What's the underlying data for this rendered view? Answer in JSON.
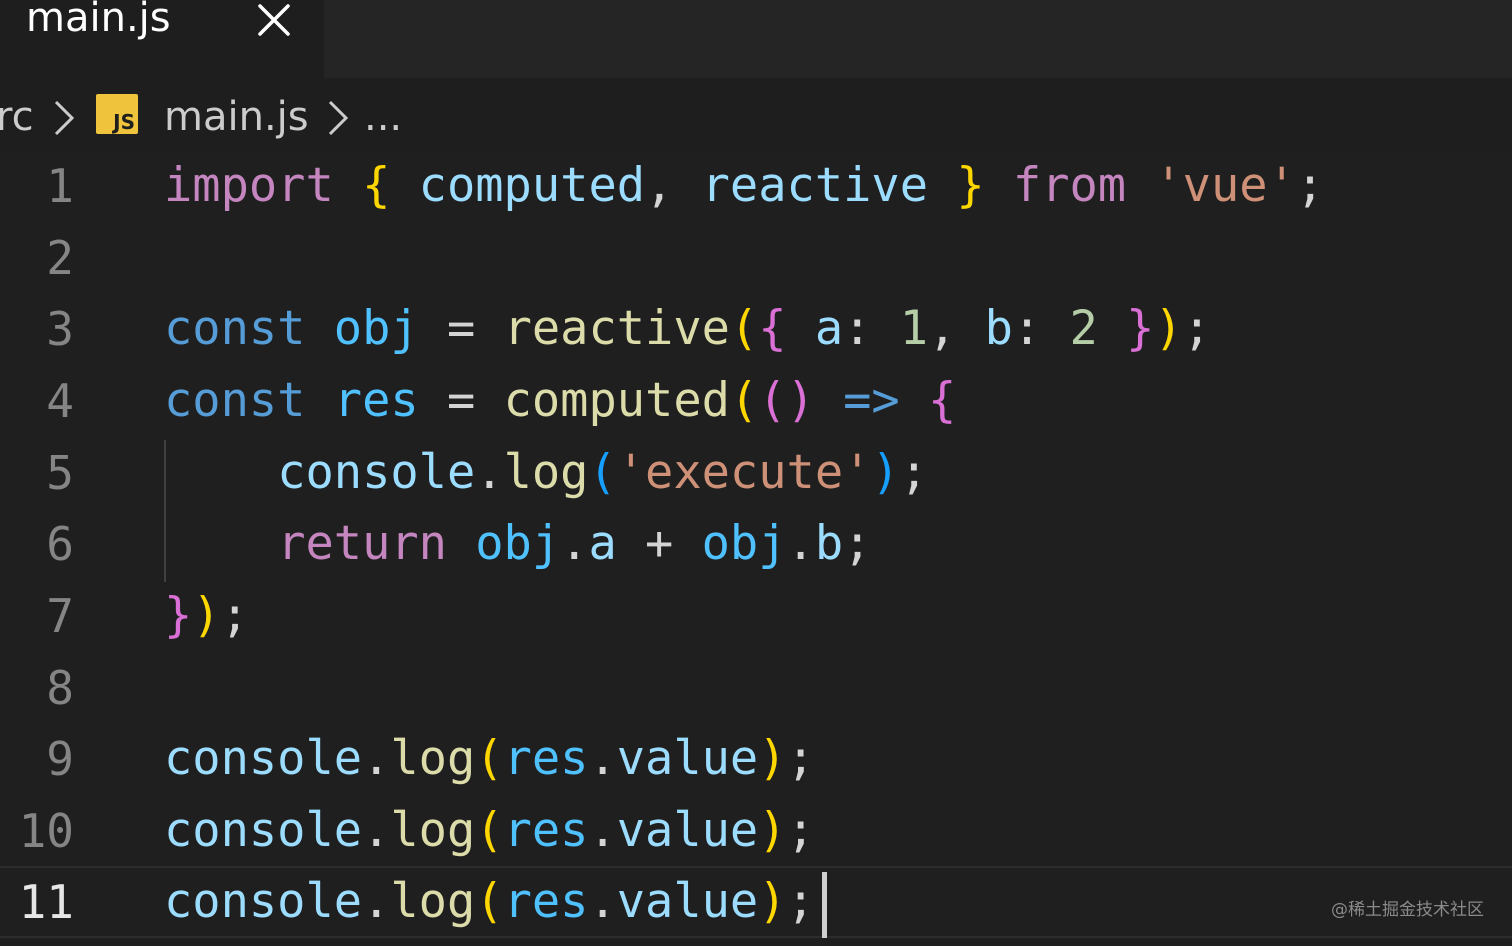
{
  "tab": {
    "title": "main.js",
    "close_icon": "close-icon"
  },
  "breadcrumb": {
    "folder": "rc",
    "file_icon": "JS",
    "file": "main.js",
    "more": "..."
  },
  "editor": {
    "lines": [
      {
        "number": "1",
        "tokens": [
          {
            "text": "import",
            "type": "ctrl"
          },
          {
            "text": " ",
            "type": "punc"
          },
          {
            "text": "{",
            "type": "b1"
          },
          {
            "text": " ",
            "type": "punc"
          },
          {
            "text": "computed",
            "type": "var"
          },
          {
            "text": ", ",
            "type": "punc"
          },
          {
            "text": "reactive",
            "type": "var"
          },
          {
            "text": " ",
            "type": "punc"
          },
          {
            "text": "}",
            "type": "b1"
          },
          {
            "text": " ",
            "type": "punc"
          },
          {
            "text": "from",
            "type": "ctrl"
          },
          {
            "text": " ",
            "type": "punc"
          },
          {
            "text": "'vue'",
            "type": "str"
          },
          {
            "text": ";",
            "type": "punc"
          }
        ]
      },
      {
        "number": "2",
        "tokens": []
      },
      {
        "number": "3",
        "tokens": [
          {
            "text": "const",
            "type": "kw"
          },
          {
            "text": " ",
            "type": "punc"
          },
          {
            "text": "obj",
            "type": "con"
          },
          {
            "text": " = ",
            "type": "op"
          },
          {
            "text": "reactive",
            "type": "fn"
          },
          {
            "text": "(",
            "type": "b1"
          },
          {
            "text": "{",
            "type": "b2"
          },
          {
            "text": " ",
            "type": "punc"
          },
          {
            "text": "a",
            "type": "var"
          },
          {
            "text": ": ",
            "type": "punc"
          },
          {
            "text": "1",
            "type": "num"
          },
          {
            "text": ", ",
            "type": "punc"
          },
          {
            "text": "b",
            "type": "var"
          },
          {
            "text": ": ",
            "type": "punc"
          },
          {
            "text": "2",
            "type": "num"
          },
          {
            "text": " ",
            "type": "punc"
          },
          {
            "text": "}",
            "type": "b2"
          },
          {
            "text": ")",
            "type": "b1"
          },
          {
            "text": ";",
            "type": "punc"
          }
        ]
      },
      {
        "number": "4",
        "tokens": [
          {
            "text": "const",
            "type": "kw"
          },
          {
            "text": " ",
            "type": "punc"
          },
          {
            "text": "res",
            "type": "con"
          },
          {
            "text": " = ",
            "type": "op"
          },
          {
            "text": "computed",
            "type": "fn"
          },
          {
            "text": "(",
            "type": "b1"
          },
          {
            "text": "()",
            "type": "b2"
          },
          {
            "text": " ",
            "type": "punc"
          },
          {
            "text": "=>",
            "type": "kw"
          },
          {
            "text": " ",
            "type": "punc"
          },
          {
            "text": "{",
            "type": "b2"
          }
        ]
      },
      {
        "number": "5",
        "tokens": [
          {
            "text": "    ",
            "type": "punc"
          },
          {
            "text": "console",
            "type": "var"
          },
          {
            "text": ".",
            "type": "punc"
          },
          {
            "text": "log",
            "type": "fn"
          },
          {
            "text": "(",
            "type": "b3"
          },
          {
            "text": "'execute'",
            "type": "str"
          },
          {
            "text": ")",
            "type": "b3"
          },
          {
            "text": ";",
            "type": "punc"
          }
        ]
      },
      {
        "number": "6",
        "tokens": [
          {
            "text": "    ",
            "type": "punc"
          },
          {
            "text": "return",
            "type": "ctrl"
          },
          {
            "text": " ",
            "type": "punc"
          },
          {
            "text": "obj",
            "type": "con"
          },
          {
            "text": ".",
            "type": "punc"
          },
          {
            "text": "a",
            "type": "var"
          },
          {
            "text": " + ",
            "type": "op"
          },
          {
            "text": "obj",
            "type": "con"
          },
          {
            "text": ".",
            "type": "punc"
          },
          {
            "text": "b",
            "type": "var"
          },
          {
            "text": ";",
            "type": "punc"
          }
        ]
      },
      {
        "number": "7",
        "tokens": [
          {
            "text": "}",
            "type": "b2"
          },
          {
            "text": ")",
            "type": "b1"
          },
          {
            "text": ";",
            "type": "punc"
          }
        ]
      },
      {
        "number": "8",
        "tokens": []
      },
      {
        "number": "9",
        "tokens": [
          {
            "text": "console",
            "type": "var"
          },
          {
            "text": ".",
            "type": "punc"
          },
          {
            "text": "log",
            "type": "fn"
          },
          {
            "text": "(",
            "type": "b1"
          },
          {
            "text": "res",
            "type": "con"
          },
          {
            "text": ".",
            "type": "punc"
          },
          {
            "text": "value",
            "type": "var"
          },
          {
            "text": ")",
            "type": "b1"
          },
          {
            "text": ";",
            "type": "punc"
          }
        ]
      },
      {
        "number": "10",
        "tokens": [
          {
            "text": "console",
            "type": "var"
          },
          {
            "text": ".",
            "type": "punc"
          },
          {
            "text": "log",
            "type": "fn"
          },
          {
            "text": "(",
            "type": "b1"
          },
          {
            "text": "res",
            "type": "con"
          },
          {
            "text": ".",
            "type": "punc"
          },
          {
            "text": "value",
            "type": "var"
          },
          {
            "text": ")",
            "type": "b1"
          },
          {
            "text": ";",
            "type": "punc"
          }
        ]
      },
      {
        "number": "11",
        "tokens": [
          {
            "text": "console",
            "type": "var"
          },
          {
            "text": ".",
            "type": "punc"
          },
          {
            "text": "log",
            "type": "fn"
          },
          {
            "text": "(",
            "type": "b1"
          },
          {
            "text": "res",
            "type": "con"
          },
          {
            "text": ".",
            "type": "punc"
          },
          {
            "text": "value",
            "type": "var"
          },
          {
            "text": ")",
            "type": "b1"
          },
          {
            "text": ";",
            "type": "punc"
          }
        ]
      }
    ],
    "current_line": "11"
  },
  "watermark": "@稀土掘金技术社区",
  "colors": {
    "background": "#1f1f1f",
    "tab_bar": "#252526",
    "js_icon": "#f0c33c",
    "keyword": "#569cd6",
    "control": "#c586c0",
    "function": "#dcdcaa",
    "string": "#ce9178",
    "variable": "#9cdcfe"
  }
}
